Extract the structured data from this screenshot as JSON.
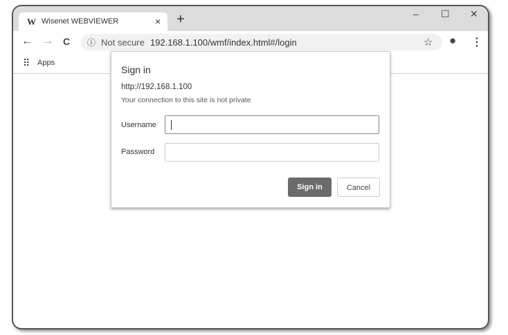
{
  "browser": {
    "tab_title": "Wisenet WEBVIEWER",
    "tab_logo": "W",
    "tab_close": "×",
    "new_tab": "+",
    "minimize": "–",
    "maximize": "☐",
    "close": "✕",
    "back": "←",
    "forward": "→",
    "reload": "C",
    "security_icon": "ⓘ",
    "security_label": "Not secure",
    "url": "192.168.1.100/wmf/index.html#/login",
    "star": "☆",
    "profile": "●",
    "menu": "⋮",
    "apps_icon": "⠿",
    "apps_label": "Apps"
  },
  "dialog": {
    "title": "Sign in",
    "site": "http://192.168.1.100",
    "warning": "Your connection to this site is not private",
    "username_label": "Username",
    "username_value": "",
    "password_label": "Password",
    "password_value": "",
    "signin_button": "Sign in",
    "cancel_button": "Cancel"
  }
}
